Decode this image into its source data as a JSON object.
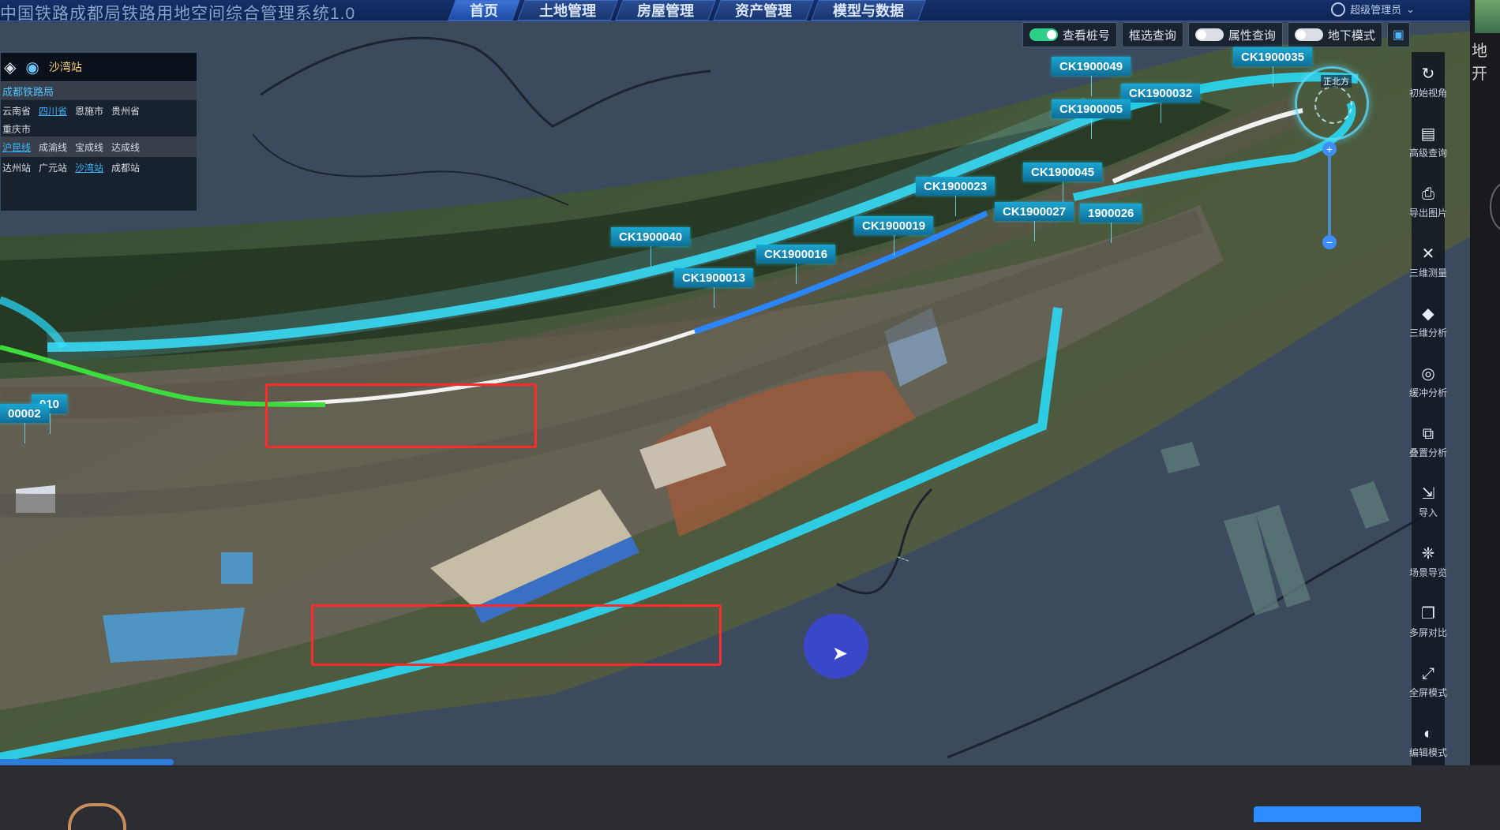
{
  "app": {
    "title": "中国铁路成都局铁路用地空间综合管理系统1.0",
    "nav_tabs": [
      {
        "label": "首页",
        "active": true
      },
      {
        "label": "土地管理",
        "active": false
      },
      {
        "label": "房屋管理",
        "active": false
      },
      {
        "label": "资产管理",
        "active": false
      },
      {
        "label": "模型与数据",
        "active": false
      }
    ],
    "user": "超级管理员"
  },
  "layer_panel": {
    "station": "沙湾站",
    "section_label": "成都铁路局",
    "regions": [
      "云南省",
      "四川省",
      "恩施市",
      "贵州省"
    ],
    "region_active": "四川省",
    "city": "重庆市",
    "lines": [
      "沪昆线",
      "成渝线",
      "宝成线",
      "达成线"
    ],
    "line_active": "沪昆线",
    "stations": [
      "达州站",
      "广元站",
      "沙湾站",
      "成都站"
    ],
    "station_active": "沙湾站"
  },
  "toggles": {
    "view_stake": {
      "label": "查看桩号",
      "on": true
    },
    "box_query": {
      "label": "框选查询"
    },
    "attr_query": {
      "label": "属性查询",
      "on": false
    },
    "underground": {
      "label": "地下模式",
      "on": false
    }
  },
  "toolbar": [
    {
      "label": "初始视角",
      "icon": "reset-view-icon"
    },
    {
      "label": "高级查询",
      "icon": "advanced-query-icon"
    },
    {
      "label": "导出图片",
      "icon": "export-image-icon"
    },
    {
      "label": "三维测量",
      "icon": "measure-icon"
    },
    {
      "label": "三维分析",
      "icon": "analysis-3d-icon"
    },
    {
      "label": "缓冲分析",
      "icon": "buffer-analysis-icon"
    },
    {
      "label": "叠置分析",
      "icon": "overlay-analysis-icon"
    },
    {
      "label": "导入",
      "icon": "import-icon"
    },
    {
      "label": "场景导览",
      "icon": "scene-tour-icon"
    },
    {
      "label": "多屏对比",
      "icon": "multi-screen-icon"
    },
    {
      "label": "全屏模式",
      "icon": "fullscreen-icon"
    },
    {
      "label": "编辑模式",
      "icon": "edit-mode-icon"
    }
  ],
  "markers": [
    {
      "label": "CK1900049"
    },
    {
      "label": "CK1900035"
    },
    {
      "label": "CK1900032"
    },
    {
      "label": "CK1900005"
    },
    {
      "label": "CK1900045"
    },
    {
      "label": "CK1900023"
    },
    {
      "label": "CK1900027"
    },
    {
      "label": "1900026"
    },
    {
      "label": "CK1900019"
    },
    {
      "label": "CK1900040"
    },
    {
      "label": "CK1900016"
    },
    {
      "label": "CK1900013"
    },
    {
      "label": "010"
    },
    {
      "label": "00002"
    }
  ],
  "compass": {
    "label": "正北方"
  },
  "edge_text": "地开",
  "colors": {
    "accent": "#1ba6d1",
    "highlight_box": "#ff2b2b",
    "route_green": "#3ddc3d"
  }
}
